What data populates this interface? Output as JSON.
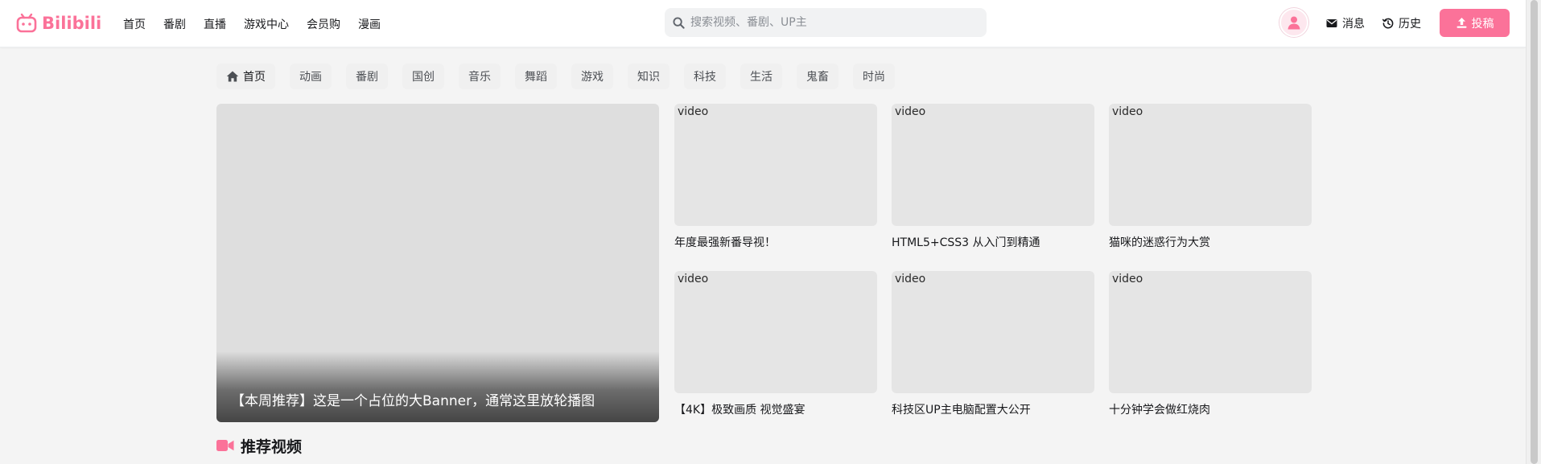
{
  "brand": {
    "name": "Bilibili",
    "accent": "#fb7299"
  },
  "nav": {
    "items": [
      {
        "label": "首页"
      },
      {
        "label": "番剧"
      },
      {
        "label": "直播"
      },
      {
        "label": "游戏中心"
      },
      {
        "label": "会员购"
      },
      {
        "label": "漫画"
      }
    ]
  },
  "search": {
    "placeholder": "搜索视频、番剧、UP主",
    "value": "",
    "icon": "search-icon"
  },
  "header_right": {
    "avatar_icon": "user-icon",
    "messages": {
      "label": "消息",
      "icon": "envelope-icon"
    },
    "history": {
      "label": "历史",
      "icon": "history-icon"
    },
    "upload": {
      "label": "投稿",
      "icon": "upload-icon"
    }
  },
  "categories": [
    {
      "label": "首页",
      "icon": "home-icon",
      "active": true
    },
    {
      "label": "动画"
    },
    {
      "label": "番剧"
    },
    {
      "label": "国创"
    },
    {
      "label": "音乐"
    },
    {
      "label": "舞蹈"
    },
    {
      "label": "游戏"
    },
    {
      "label": "知识"
    },
    {
      "label": "科技"
    },
    {
      "label": "生活"
    },
    {
      "label": "鬼畜"
    },
    {
      "label": "时尚"
    }
  ],
  "banner": {
    "caption": "【本周推荐】这是一个占位的大Banner，通常这里放轮播图"
  },
  "videos": [
    {
      "alt": "video",
      "title": "年度最强新番导视！"
    },
    {
      "alt": "video",
      "title": "HTML5+CSS3 从入门到精通"
    },
    {
      "alt": "video",
      "title": "猫咪的迷惑行为大赏"
    },
    {
      "alt": "video",
      "title": "【4K】极致画质 视觉盛宴"
    },
    {
      "alt": "video",
      "title": "科技区UP主电脑配置大公开"
    },
    {
      "alt": "video",
      "title": "十分钟学会做红烧肉"
    }
  ],
  "section": {
    "title": "推荐视频",
    "icon": "video-camera-icon"
  }
}
